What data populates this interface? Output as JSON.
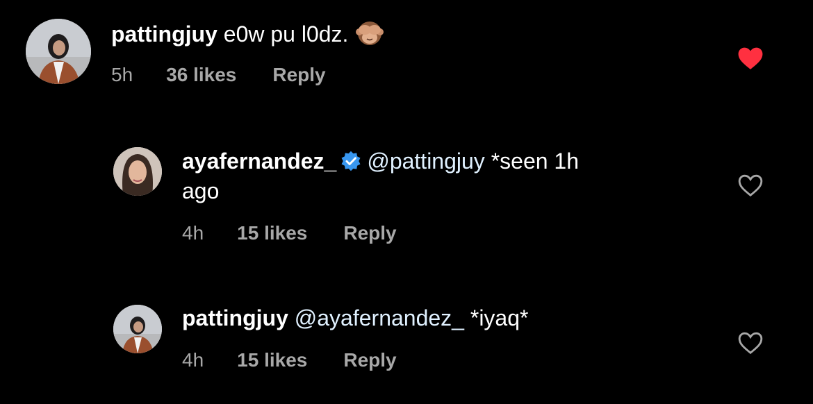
{
  "comments": [
    {
      "username": "pattingjuy",
      "text": "e0w pu l0dz.",
      "emoji": "see-no-evil-monkey",
      "time": "5h",
      "likes": "36 likes",
      "reply": "Reply",
      "liked": true
    },
    {
      "username": "ayafernandez_",
      "verified": true,
      "mention": "@pattingjuy",
      "text_line1": "*seen 1h",
      "text_line2": "ago",
      "time": "4h",
      "likes": "15 likes",
      "reply": "Reply",
      "liked": false
    },
    {
      "username": "pattingjuy",
      "mention": "@ayafernandez_",
      "text": "*iyaq*",
      "time": "4h",
      "likes": "15 likes",
      "reply": "Reply",
      "liked": false
    }
  ],
  "colors": {
    "background": "#000000",
    "text": "#ffffff",
    "meta": "#a8a8a8",
    "mention": "#e0f1ff",
    "liked_heart": "#ff3040",
    "verified": "#3897f0"
  }
}
